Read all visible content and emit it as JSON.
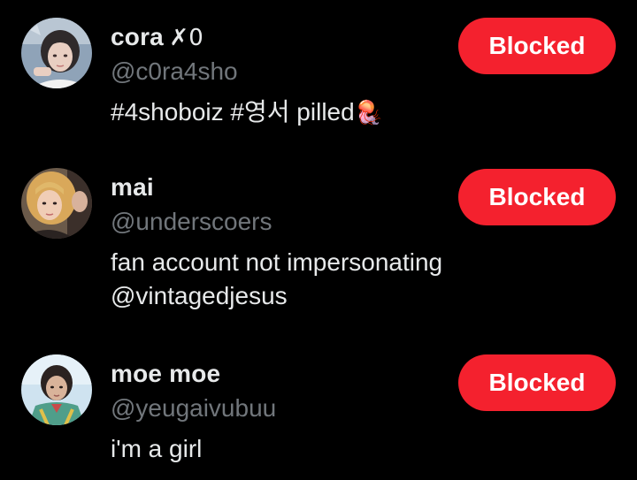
{
  "users": [
    {
      "display_name": "cora",
      "name_emoji": "✗0",
      "handle": "@c0ra4sho",
      "bio": "#4shoboiz #영서 pilled",
      "bio_emoji": "🪼",
      "button_label": "Blocked"
    },
    {
      "display_name": "mai",
      "handle": "@underscoers",
      "bio": "fan account not impersonating\n@vintagedjesus",
      "button_label": "Blocked"
    },
    {
      "display_name": "moe moe",
      "handle": "@yeugaivubuu",
      "bio": "i'm a girl",
      "button_label": "Blocked"
    }
  ],
  "colors": {
    "background": "#000000",
    "primary_text": "#e7e9ea",
    "secondary_text": "#71767b",
    "blocked_button": "#f4212e",
    "button_text": "#ffffff"
  }
}
